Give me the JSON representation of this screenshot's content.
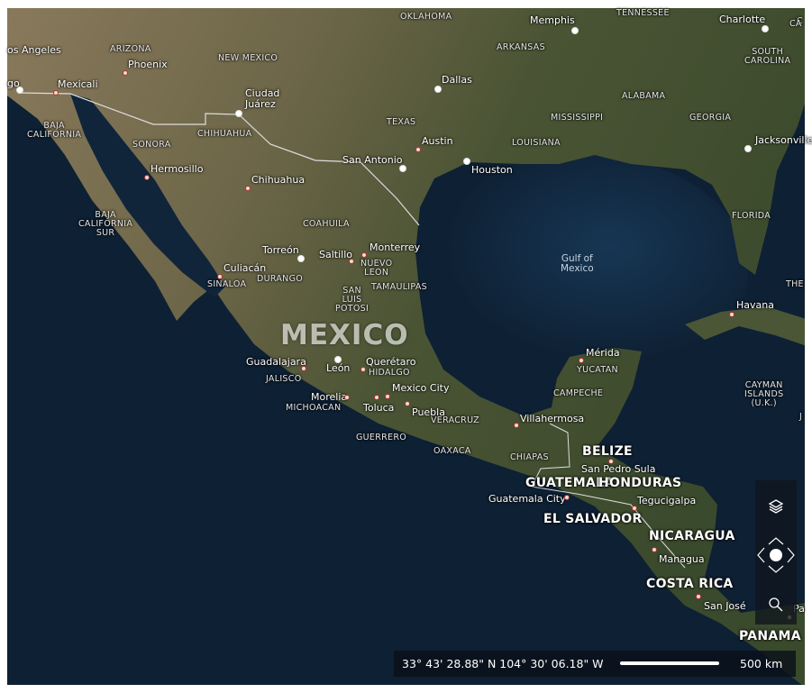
{
  "map": {
    "style": "aerial",
    "colors": {
      "water": "#0e2033",
      "gulf": "#14304a",
      "land_desert": "#8a7a5c",
      "land_green": "#3d4d2e",
      "border": "#e8e8e8"
    },
    "big_label": "MEXICO",
    "countries": [
      "BELIZE",
      "GUATEMALA",
      "HONDURAS",
      "EL SALVADOR",
      "NICARAGUA",
      "COSTA RICA",
      "PANAMA"
    ],
    "states": [
      "OKLAHOMA",
      "TENNESSEE",
      "ARKANSAS",
      "ARIZONA",
      "NEW MEXICO",
      "SOUTH\nCAROLINA",
      "ALABAMA",
      "MISSISSIPPI",
      "GEORGIA",
      "TEXAS",
      "LOUISIANA",
      "BAJA\nCALIFORNIA",
      "CHIHUAHUA",
      "SONORA",
      "FLORIDA",
      "BAJA\nCALIFORNIA\nSUR",
      "COAHUILA",
      "NUEVO\nLEON",
      "TAMAULIPAS",
      "SINALOA",
      "DURANGO",
      "SAN\nLUIS\nPOTOSI",
      "YUCATAN",
      "CAMPECHE",
      "JALISCO",
      "HIDALGO",
      "MICHOACAN",
      "VERACRUZ",
      "GUERRERO",
      "OAXACA",
      "CHIAPAS",
      "CAYMAN\nISLANDS\n(U.K.)",
      "THE",
      "C",
      "CA",
      "J"
    ],
    "water_labels": [
      "Gulf of\nMexico"
    ],
    "cities": [
      "os Angeles",
      "Phoenix",
      "Mexicali",
      "go",
      "Ciudad\nJuárez",
      "Dallas",
      "Memphis",
      "Charlotte",
      "Austin",
      "San Antonio",
      "Houston",
      "Jacksonville",
      "Hermosillo",
      "Chihuahua",
      "Culiacán",
      "Torreón",
      "Saltillo",
      "Monterrey",
      "Havana",
      "Mérida",
      "Guadalajara",
      "León",
      "Querétaro",
      "Mexico City",
      "Morelia",
      "Toluca",
      "Puebla",
      "Villahermosa",
      "San Pedro Sula",
      "Guatemala City",
      "Tegucigalpa",
      "Managua",
      "San José",
      "Pa"
    ]
  },
  "controls": {
    "layers_icon": "layers-icon",
    "pan_icon": "pan-compass-icon",
    "search_icon": "search-icon"
  },
  "status_bar": {
    "coordinates": "33° 43' 28.88\" N 104° 30' 06.18\" W",
    "scale_label": "500 km"
  }
}
